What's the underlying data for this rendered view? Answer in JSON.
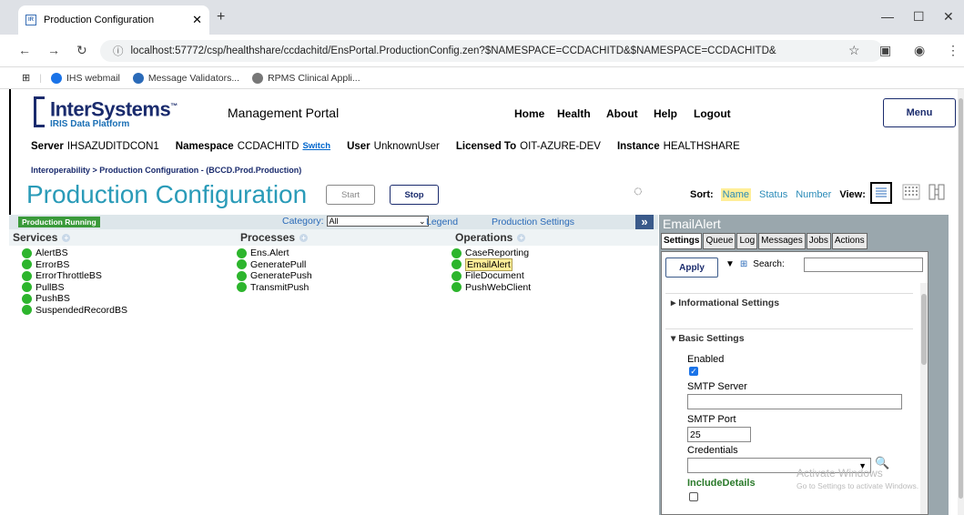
{
  "browser": {
    "tab_title": "Production Configuration",
    "favicon_text": "IR",
    "url": "localhost:57772/csp/healthshare/ccdachitd/EnsPortal.ProductionConfig.zen?$NAMESPACE=CCDACHITD&$NAMESPACE=CCDACHITD&",
    "bookmarks": [
      {
        "label": "IHS webmail",
        "color": "#1a73e8"
      },
      {
        "label": "Message Validators...",
        "color": "#2a6ab8"
      },
      {
        "label": "RPMS Clinical Appli...",
        "color": "#777777"
      }
    ]
  },
  "header": {
    "logo_main": "InterSystems",
    "logo_tm": "™",
    "logo_sub": "IRIS Data Platform",
    "portal_title": "Management Portal",
    "nav": [
      "Home",
      "Health",
      "About",
      "Help",
      "Logout"
    ],
    "menu_label": "Menu",
    "server_label": "Server",
    "server_value": "IHSAZUDITDCON1",
    "namespace_label": "Namespace",
    "namespace_value": "CCDACHITD",
    "switch_label": "Switch",
    "user_label": "User",
    "user_value": "UnknownUser",
    "licensed_label": "Licensed To",
    "licensed_value": "OIT-AZURE-DEV",
    "instance_label": "Instance",
    "instance_value": "HEALTHSHARE"
  },
  "breadcrumb": "Interoperability > Production Configuration  - (BCCD.Prod.Production)",
  "page_title": "Production Configuration",
  "actions": {
    "start": "Start",
    "stop": "Stop"
  },
  "sort": {
    "label": "Sort:",
    "options": [
      "Name",
      "Status",
      "Number"
    ],
    "selected": "Name",
    "view_label": "View:"
  },
  "toolbar": {
    "status": "Production Running",
    "category_label": "Category:",
    "category_value": "All",
    "legend": "Legend",
    "production_settings": "Production Settings",
    "expand": "»"
  },
  "columns": {
    "services": {
      "title": "Services",
      "items": [
        "AlertBS",
        "ErrorBS",
        "ErrorThrottleBS",
        "PullBS",
        "PushBS",
        "SuspendedRecordBS"
      ]
    },
    "processes": {
      "title": "Processes",
      "items": [
        "Ens.Alert",
        "GeneratePull",
        "GeneratePush",
        "TransmitPush"
      ]
    },
    "operations": {
      "title": "Operations",
      "items": [
        "CaseReporting",
        "EmailAlert",
        "FileDocument",
        "PushWebClient"
      ],
      "selected": "EmailAlert"
    }
  },
  "detail": {
    "title": "EmailAlert",
    "tabs": [
      "Settings",
      "Queue",
      "Log",
      "Messages",
      "Jobs",
      "Actions"
    ],
    "active_tab": "Settings",
    "apply": "Apply",
    "search_label": "Search:",
    "informational_settings": "Informational Settings",
    "basic_settings": "Basic Settings",
    "enabled_label": "Enabled",
    "enabled": true,
    "smtp_server_label": "SMTP Server",
    "smtp_server_value": "",
    "smtp_port_label": "SMTP Port",
    "smtp_port_value": "25",
    "credentials_label": "Credentials",
    "include_details_label": "IncludeDetails",
    "include_details": false
  },
  "watermark": {
    "line1": "Activate Windows",
    "line2": "Go to Settings to activate Windows."
  }
}
